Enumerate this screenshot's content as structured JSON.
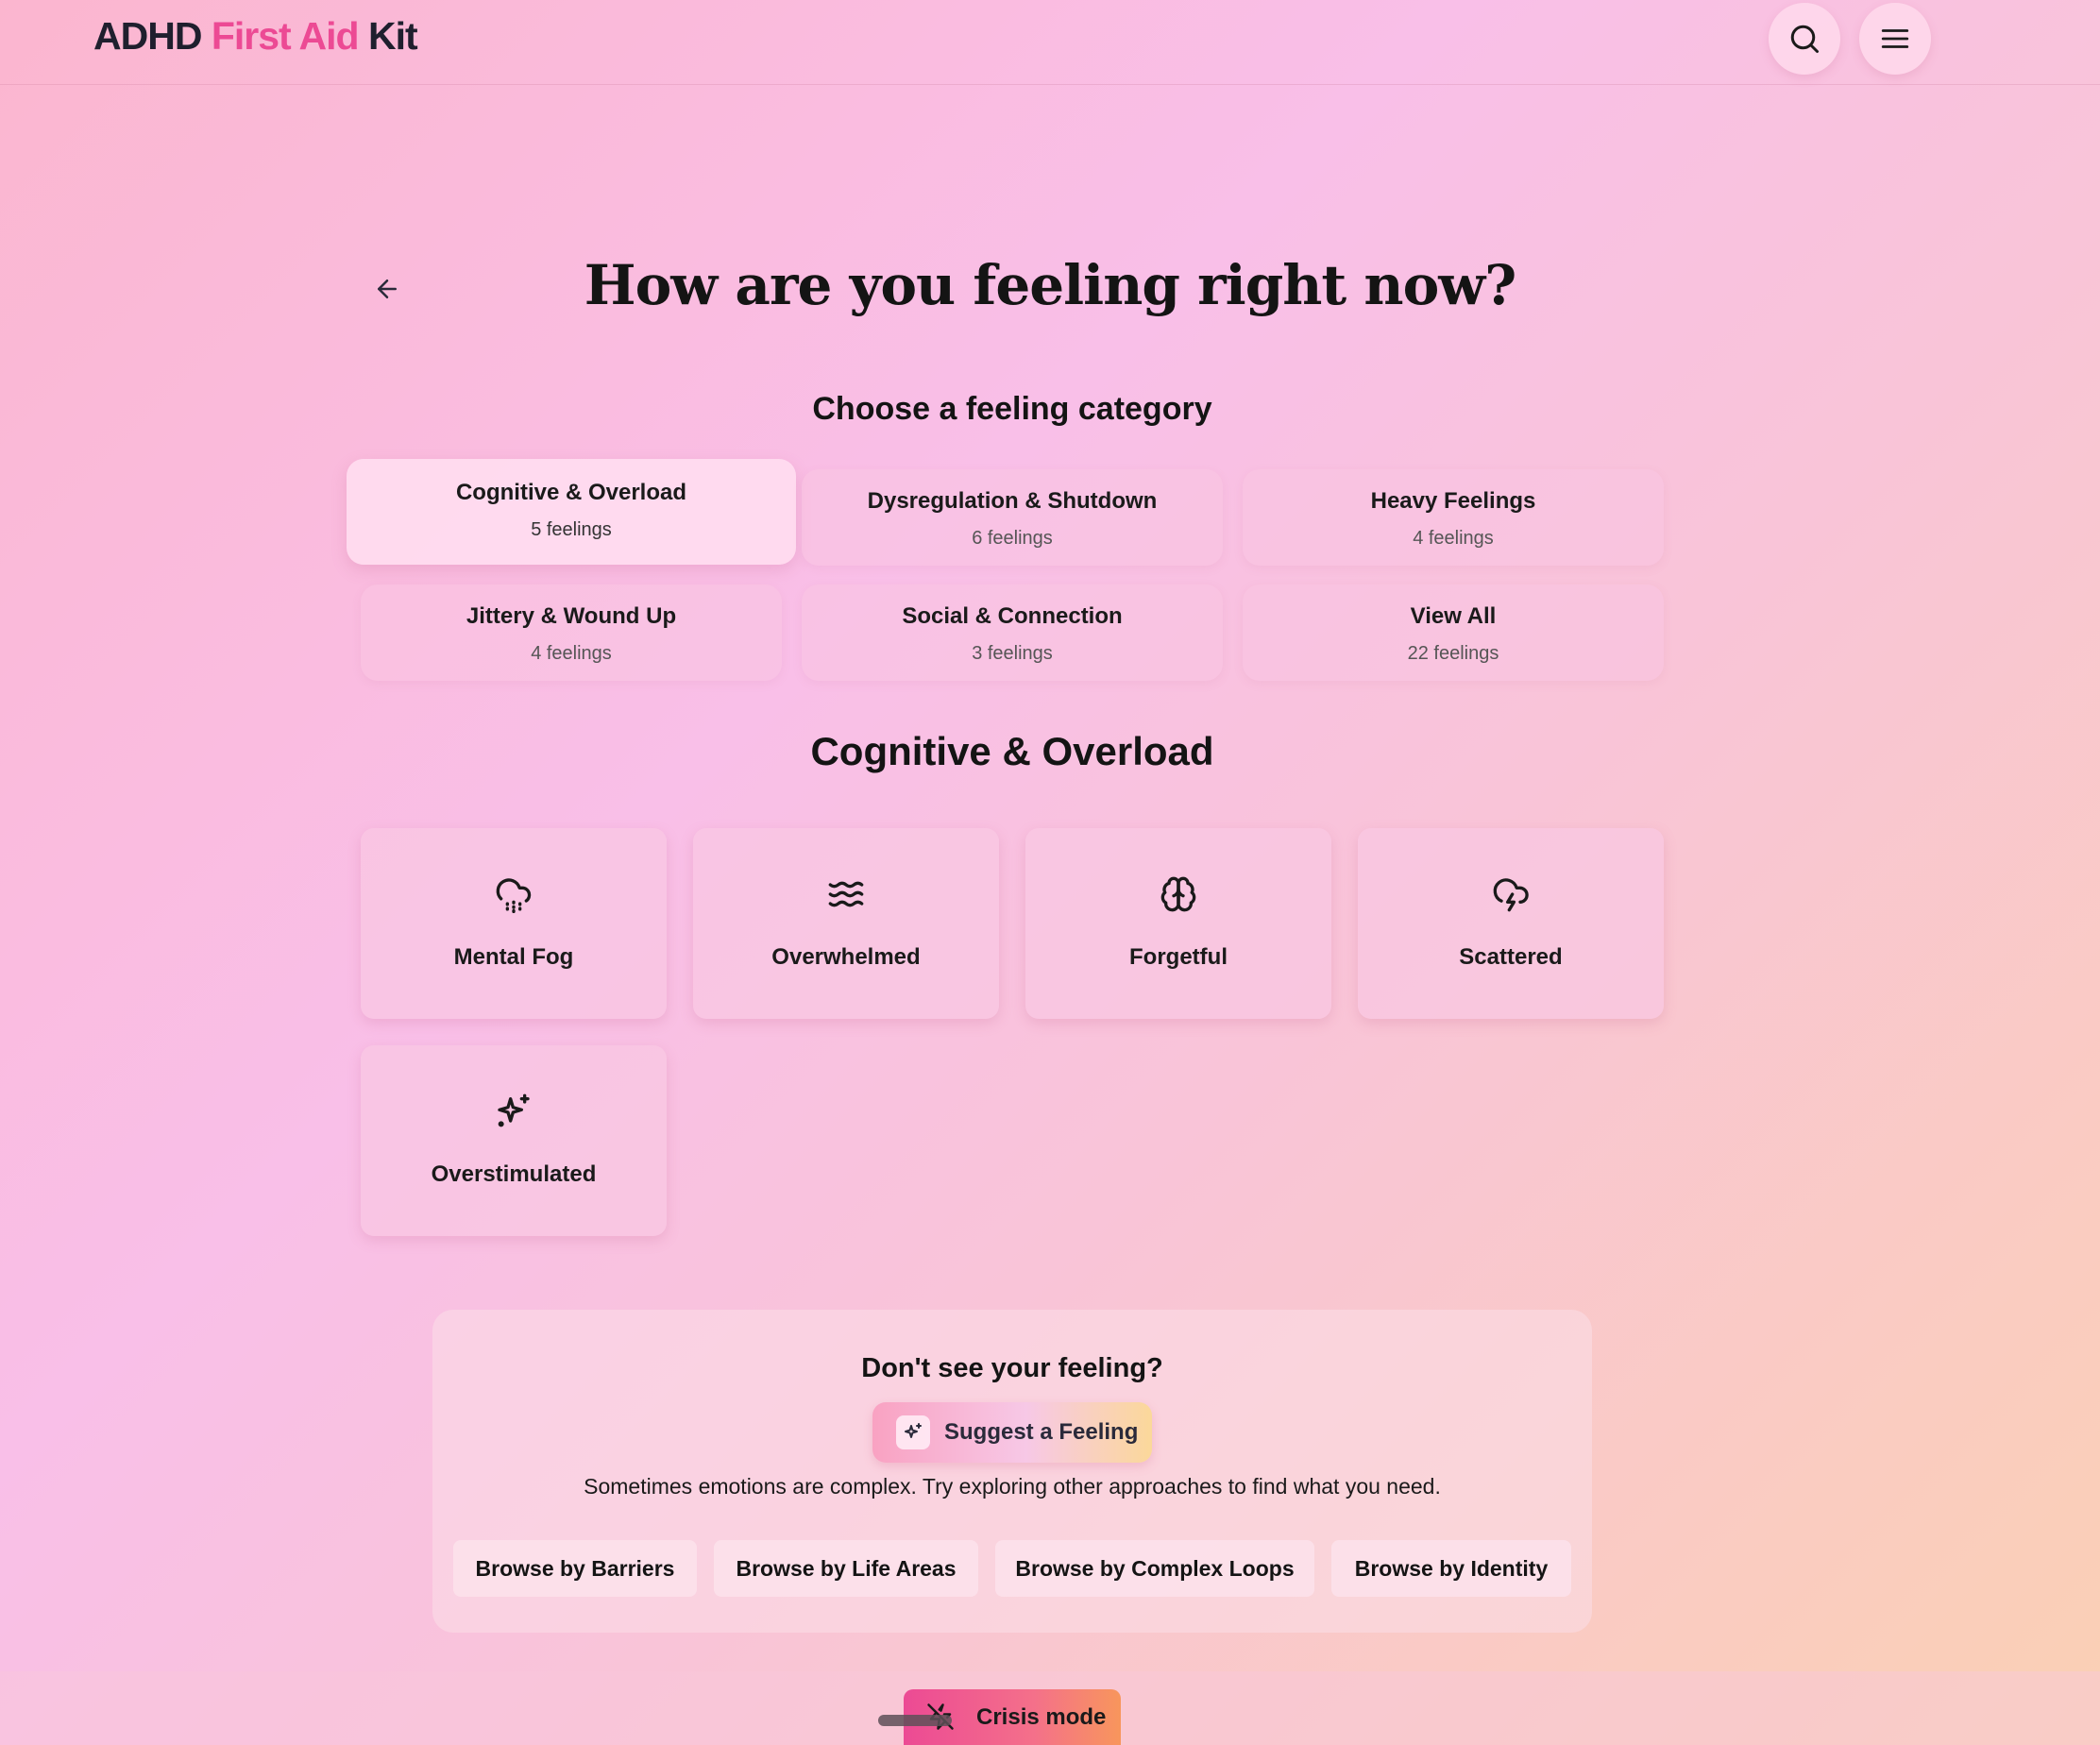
{
  "header": {
    "logo_part1": "ADHD ",
    "logo_accent": "First Aid",
    "logo_part3": " Kit",
    "accent_color": "#ec4a94",
    "search_icon": "search-icon",
    "menu_icon": "hamburger-menu-icon"
  },
  "page": {
    "title": "How are you feeling right now?",
    "choose_label": "Choose a feeling category",
    "back_icon": "arrow-left-icon"
  },
  "categories": [
    {
      "name": "Cognitive & Overload",
      "count": "5 feelings",
      "active": true
    },
    {
      "name": "Dysregulation & Shutdown",
      "count": "6 feelings"
    },
    {
      "name": "Heavy Feelings",
      "count": "4 feelings"
    },
    {
      "name": "Jittery & Wound Up",
      "count": "4 feelings"
    },
    {
      "name": "Social & Connection",
      "count": "3 feelings"
    },
    {
      "name": "View All",
      "count": "22 feelings"
    }
  ],
  "selected_category": "Cognitive & Overload",
  "feelings": [
    {
      "label": "Mental Fog",
      "icon": "cloud-drizzle-icon"
    },
    {
      "label": "Overwhelmed",
      "icon": "waves-icon"
    },
    {
      "label": "Forgetful",
      "icon": "brain-icon"
    },
    {
      "label": "Scattered",
      "icon": "cloud-lightning-icon"
    },
    {
      "label": "Overstimulated",
      "icon": "sparkles-icon"
    }
  ],
  "suggest": {
    "title": "Don't see your feeling?",
    "button_label": "Suggest a Feeling",
    "button_icon": "sparkle-icon",
    "text": "Sometimes emotions are complex. Try exploring other approaches to find what you need.",
    "browse": [
      "Browse by Barriers",
      "Browse by Life Areas",
      "Browse by Complex Loops",
      "Browse by Identity"
    ]
  },
  "footer": {
    "crisis_label": "Crisis mode",
    "crisis_icon": "zap-off-icon"
  }
}
